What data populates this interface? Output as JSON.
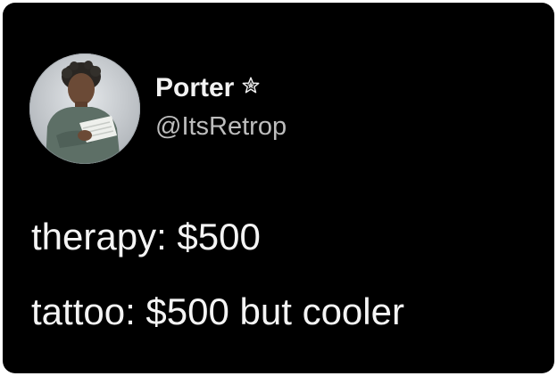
{
  "author": {
    "display_name": "Porter",
    "handle": "@ItsRetrop",
    "badge_icon": "star-outline-icon",
    "avatar_icon": "avatar-photo"
  },
  "tweet": {
    "lines": [
      "therapy: $500",
      "tattoo: $500 but cooler"
    ]
  },
  "colors": {
    "background": "#000000",
    "text": "#f4f4f4",
    "handle_text": "#bdbdbd"
  }
}
